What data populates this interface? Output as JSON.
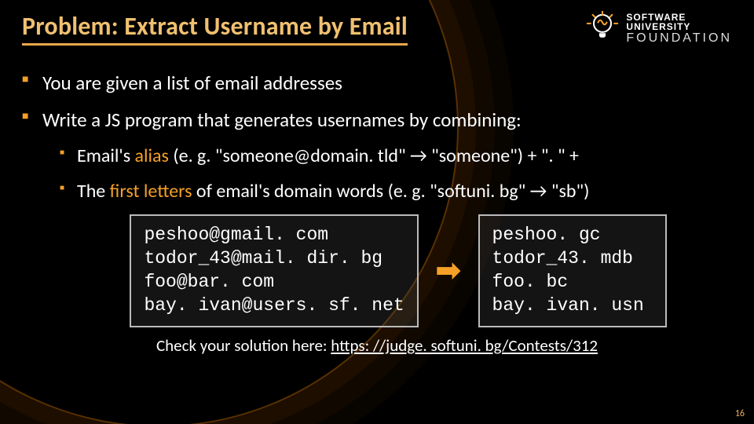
{
  "title": "Problem: Extract Username by Email",
  "logo": {
    "line1": "SOFTWARE",
    "line2": "UNIVERSITY",
    "line3": "FOUNDATION"
  },
  "bullets": {
    "b1": "You are given a list of email addresses",
    "b2": "Write a JS program that generates usernames by combining:",
    "sub1_pre": "Email's ",
    "sub1_orange": "alias",
    "sub1_post": " (e. g. \"someone@domain. tld\" ",
    "sub1_arrow": "→",
    "sub1_post2": " \"someone\")  + \". \" +",
    "sub2_pre": "The ",
    "sub2_orange": "first letters",
    "sub2_post": " of email's domain words (e. g. \"softuni. bg\" ",
    "sub2_arrow": "→",
    "sub2_post2": " \"sb\")"
  },
  "code_input": "peshoo@gmail. com\ntodor_43@mail. dir. bg\nfoo@bar. com\nbay. ivan@users. sf. net",
  "code_output": "peshoo. gc\ntodor_43. mdb\nfoo. bc\nbay. ivan. usn",
  "arrow": "➡",
  "footer_text": "Check your solution here: ",
  "footer_link": "https: //judge. softuni. bg/Contests/312",
  "page_number": "16"
}
